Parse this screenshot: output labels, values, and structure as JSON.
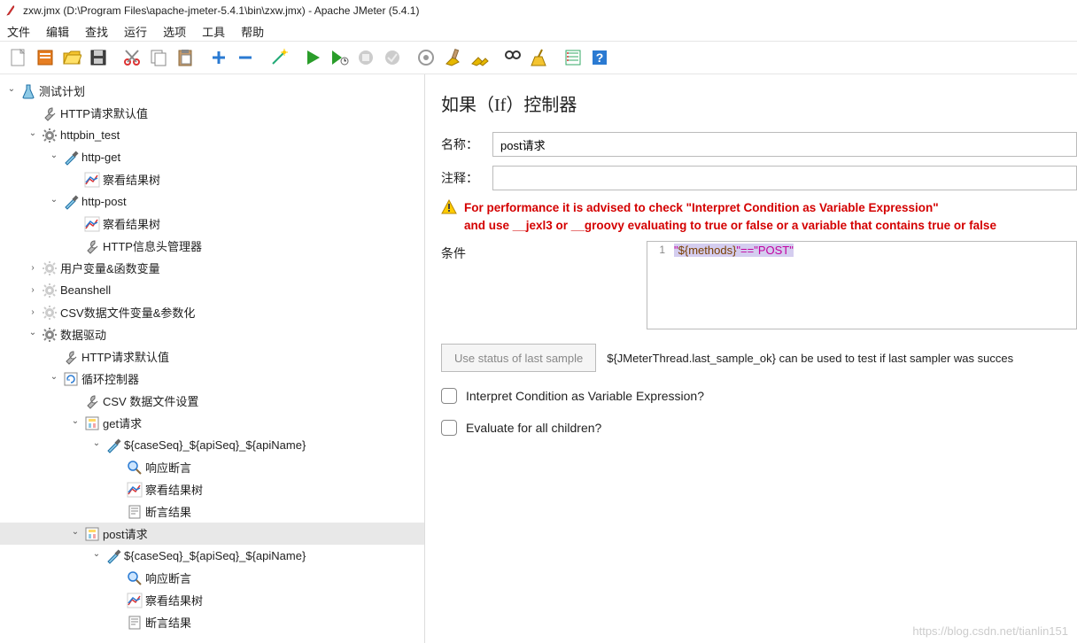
{
  "window": {
    "title": "zxw.jmx (D:\\Program Files\\apache-jmeter-5.4.1\\bin\\zxw.jmx) - Apache JMeter (5.4.1)"
  },
  "menu": [
    "文件",
    "编辑",
    "查找",
    "运行",
    "选项",
    "工具",
    "帮助"
  ],
  "toolbar_icons": [
    "new-file",
    "templates",
    "open",
    "save",
    "cut",
    "copy",
    "paste",
    "add",
    "remove",
    "wand",
    "run",
    "run-no-timers",
    "stop",
    "shutdown",
    "toggle",
    "clear",
    "clear-all",
    "search",
    "broom",
    "options",
    "help"
  ],
  "tree": [
    {
      "d": 0,
      "caret": "v",
      "icon": "beaker",
      "label": "测试计划"
    },
    {
      "d": 1,
      "caret": "",
      "icon": "wrench",
      "label": "HTTP请求默认值"
    },
    {
      "d": 1,
      "caret": "v",
      "icon": "gear",
      "label": "httpbin_test"
    },
    {
      "d": 2,
      "caret": "v",
      "icon": "pipette",
      "label": "http-get"
    },
    {
      "d": 3,
      "caret": "",
      "icon": "chart",
      "label": "察看结果树"
    },
    {
      "d": 2,
      "caret": "v",
      "icon": "pipette",
      "label": "http-post"
    },
    {
      "d": 3,
      "caret": "",
      "icon": "chart",
      "label": "察看结果树"
    },
    {
      "d": 3,
      "caret": "",
      "icon": "wrench",
      "label": "HTTP信息头管理器"
    },
    {
      "d": 1,
      "caret": ">",
      "icon": "gear-dim",
      "label": "用户变量&函数变量"
    },
    {
      "d": 1,
      "caret": ">",
      "icon": "gear-dim",
      "label": "Beanshell"
    },
    {
      "d": 1,
      "caret": ">",
      "icon": "gear-dim",
      "label": "CSV数据文件变量&参数化"
    },
    {
      "d": 1,
      "caret": "v",
      "icon": "gear",
      "label": "数据驱动"
    },
    {
      "d": 2,
      "caret": "",
      "icon": "wrench",
      "label": "HTTP请求默认值"
    },
    {
      "d": 2,
      "caret": "v",
      "icon": "loop",
      "label": "循环控制器"
    },
    {
      "d": 3,
      "caret": "",
      "icon": "wrench",
      "label": "CSV 数据文件设置"
    },
    {
      "d": 3,
      "caret": "v",
      "icon": "if",
      "label": "get请求"
    },
    {
      "d": 4,
      "caret": "v",
      "icon": "pipette",
      "label": "${caseSeq}_${apiSeq}_${apiName}"
    },
    {
      "d": 5,
      "caret": "",
      "icon": "lens",
      "label": "响应断言"
    },
    {
      "d": 5,
      "caret": "",
      "icon": "chart",
      "label": "察看结果树"
    },
    {
      "d": 5,
      "caret": "",
      "icon": "doc",
      "label": "断言结果"
    },
    {
      "d": 3,
      "caret": "v",
      "icon": "if",
      "label": "post请求",
      "sel": true
    },
    {
      "d": 4,
      "caret": "v",
      "icon": "pipette",
      "label": "${caseSeq}_${apiSeq}_${apiName}"
    },
    {
      "d": 5,
      "caret": "",
      "icon": "lens",
      "label": "响应断言"
    },
    {
      "d": 5,
      "caret": "",
      "icon": "chart",
      "label": "察看结果树"
    },
    {
      "d": 5,
      "caret": "",
      "icon": "doc",
      "label": "断言结果"
    }
  ],
  "panel": {
    "title": "如果（If）控制器",
    "name_label": "名称：",
    "name_value": "post请求",
    "comment_label": "注释：",
    "comment_value": "",
    "warn_line1": "For performance it is advised to check \"Interpret Condition as Variable Expression\"",
    "warn_line2": "and use __jexl3 or __groovy evaluating to true or false or a variable that contains true or false",
    "cond_label": "条件",
    "code_line_no": "1",
    "code_q1": "\"",
    "code_var1": "${",
    "code_var2": "methods",
    "code_var3": "}",
    "code_mid": "\"==\"",
    "code_post": "POST",
    "code_q2": "\"",
    "status_btn": "Use status of last sample",
    "status_text": "${JMeterThread.last_sample_ok} can be used to test if last sampler was succes",
    "check1": "Interpret Condition as Variable Expression?",
    "check2": "Evaluate for all children?"
  },
  "watermark": "https://blog.csdn.net/tianlin151"
}
